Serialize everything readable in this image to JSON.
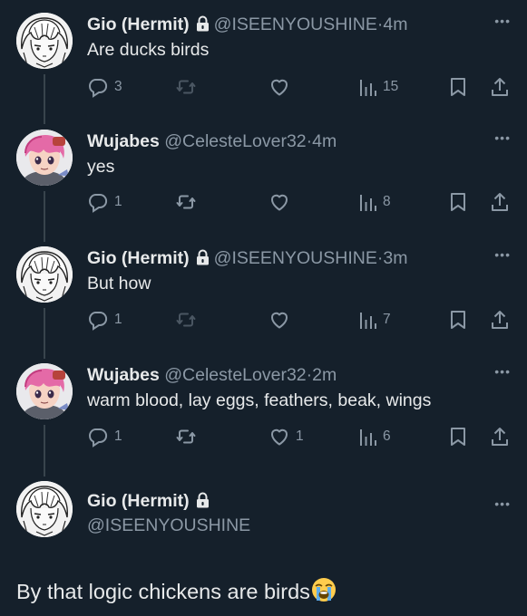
{
  "thread": {
    "replies": [
      {
        "author": {
          "name": "Gio (Hermit)",
          "handle": "@ISEENYOUSHINE",
          "time": "4m",
          "avatar": "avatar-gio",
          "locked": true
        },
        "text": "Are ducks birds",
        "actions": {
          "replies": "3",
          "reposts": "",
          "likes": "",
          "views": "15"
        },
        "retweet_dimmed": true
      },
      {
        "author": {
          "name": "Wujabes",
          "handle": "@CelesteLover32",
          "time": "4m",
          "avatar": "avatar-wujabes",
          "locked": false
        },
        "text": "yes",
        "actions": {
          "replies": "1",
          "reposts": "",
          "likes": "",
          "views": "8"
        },
        "retweet_dimmed": false
      },
      {
        "author": {
          "name": "Gio (Hermit)",
          "handle": "@ISEENYOUSHINE",
          "time": "3m",
          "avatar": "avatar-gio",
          "locked": true
        },
        "text": "But how",
        "actions": {
          "replies": "1",
          "reposts": "",
          "likes": "",
          "views": "7"
        },
        "retweet_dimmed": true
      },
      {
        "author": {
          "name": "Wujabes",
          "handle": "@CelesteLover32",
          "time": "2m",
          "avatar": "avatar-wujabes",
          "locked": false
        },
        "text": "warm blood, lay eggs, feathers, beak, wings",
        "actions": {
          "replies": "1",
          "reposts": "",
          "likes": "1",
          "views": "6"
        },
        "retweet_dimmed": false
      }
    ],
    "main": {
      "author": {
        "name": "Gio (Hermit)",
        "handle": "@ISEENYOUSHINE",
        "locked": true
      },
      "text": "By that logic chickens are birds",
      "emoji": "loudly-crying-face"
    },
    "separator": "·",
    "more_label": "•••"
  },
  "colors": {
    "background": "#15202b",
    "text_primary": "#e7e9ea",
    "text_secondary": "#8b98a5",
    "thread_line": "#38444d"
  },
  "icons": [
    "reply-icon",
    "retweet-icon",
    "like-icon",
    "views-icon",
    "bookmark-icon",
    "share-icon",
    "lock-icon",
    "more-icon"
  ]
}
